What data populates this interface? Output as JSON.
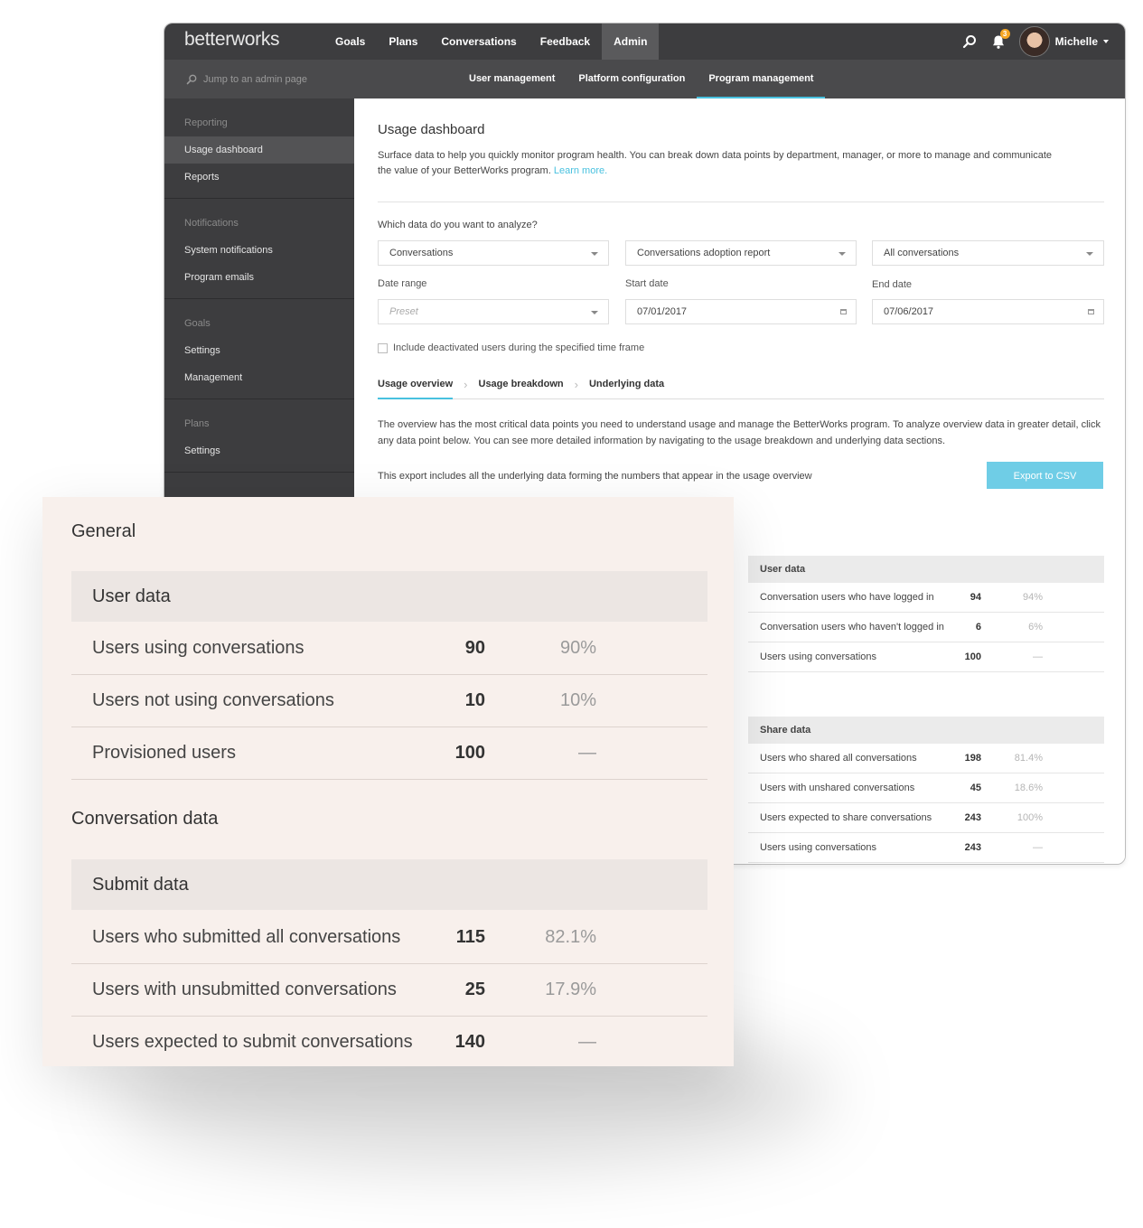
{
  "app": {
    "logo": "betterworks",
    "nav": [
      "Goals",
      "Plans",
      "Conversations",
      "Feedback",
      "Admin"
    ],
    "active_nav": "Admin",
    "user_name": "Michelle",
    "notification_count": "3"
  },
  "subbar": {
    "search_placeholder": "Jump to an admin page",
    "tabs": [
      "User management",
      "Platform configuration",
      "Program management"
    ]
  },
  "sidebar": {
    "groups": [
      {
        "heading": "Reporting",
        "items": [
          "Usage dashboard",
          "Reports"
        ]
      },
      {
        "heading": "Notifications",
        "items": [
          "System notifications",
          "Program emails"
        ]
      },
      {
        "heading": "Goals",
        "items": [
          "Settings",
          "Management"
        ]
      },
      {
        "heading": "Plans",
        "items": [
          "Settings"
        ]
      }
    ]
  },
  "main": {
    "title": "Usage dashboard",
    "description": "Surface data to help you quickly monitor program health. You can break down data points by department, manager, or more to manage and communicate the value of your BetterWorks program.",
    "learn_more": "Learn more.",
    "question": "Which data do you want to analyze?",
    "select_type": "Conversations",
    "select_report": "Conversations adoption report",
    "select_filter": "All conversations",
    "date_range_label": "Date range",
    "date_range_placeholder": "Preset",
    "start_label": "Start date",
    "start_value": "07/01/2017",
    "end_label": "End date",
    "end_value": "07/06/2017",
    "checkbox_label": "Include deactivated users during the specified time frame",
    "tabs": [
      "Usage overview",
      "Usage breakdown",
      "Underlying data"
    ],
    "overview_text": "The overview has the most critical data points you need to understand usage and manage the BetterWorks program. To analyze overview data in greater detail, click any data point below. You can see more detailed information by navigating to the usage breakdown and underlying data sections.",
    "export_text": "This export includes all the underlying data forming the numbers that appear in the usage overview",
    "export_button": "Export to CSV"
  },
  "user_data_table": {
    "heading": "User data",
    "rows": [
      {
        "label": "Conversation users who have logged in",
        "value": "94",
        "pct": "94%"
      },
      {
        "label": "Conversation users who haven't logged in",
        "value": "6",
        "pct": "6%"
      },
      {
        "label": "Users using conversations",
        "value": "100",
        "pct": "—"
      }
    ]
  },
  "share_data_table": {
    "heading": "Share data",
    "rows": [
      {
        "label": "Users who shared all conversations",
        "value": "198",
        "pct": "81.4%"
      },
      {
        "label": "Users with unshared conversations",
        "value": "45",
        "pct": "18.6%"
      },
      {
        "label": "Users expected to share conversations",
        "value": "243",
        "pct": "100%"
      },
      {
        "label": "Users using conversations",
        "value": "243",
        "pct": "—"
      }
    ]
  },
  "card": {
    "general_heading": "General",
    "user_data": {
      "heading": "User data",
      "rows": [
        {
          "label": "Users using conversations",
          "value": "90",
          "pct": "90%"
        },
        {
          "label": "Users not using conversations",
          "value": "10",
          "pct": "10%"
        },
        {
          "label": "Provisioned users",
          "value": "100",
          "pct": "—"
        }
      ]
    },
    "conversation_heading": "Conversation data",
    "submit_data": {
      "heading": "Submit data",
      "rows": [
        {
          "label": "Users who submitted all conversations",
          "value": "115",
          "pct": "82.1%"
        },
        {
          "label": "Users with unsubmitted conversations",
          "value": "25",
          "pct": "17.9%"
        },
        {
          "label": "Users expected to submit conversations",
          "value": "140",
          "pct": "—"
        }
      ]
    }
  }
}
